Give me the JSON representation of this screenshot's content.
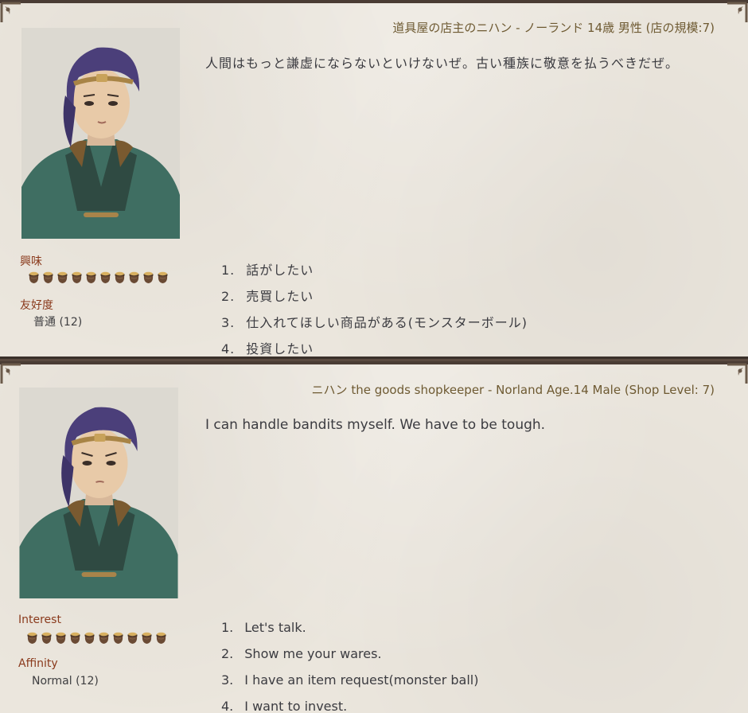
{
  "colors": {
    "paper": "#ebe6dd",
    "header_text": "#6e5a32",
    "stat_label": "#8a3a1c",
    "body_text": "#3b3b40",
    "frame": "#3a302a"
  },
  "jp": {
    "header": "道具屋の店主のニハン - ノーランド 14歳 男性 (店の規模:7)",
    "dialogue": "人間はもっと謙虚にならないといけないぜ。古い種族に敬意を払うべきだぜ。",
    "interest_label": "興味",
    "interest_level": 10,
    "affinity_label": "友好度",
    "affinity_value": "普通 (12)",
    "choices": [
      {
        "num": "1.",
        "text": "話がしたい"
      },
      {
        "num": "2.",
        "text": "売買したい"
      },
      {
        "num": "3.",
        "text": "仕入れてほしい商品がある(モンスターボール)"
      },
      {
        "num": "4.",
        "text": "投資したい"
      }
    ]
  },
  "en": {
    "header": "ニハン the goods shopkeeper - Norland Age.14 Male (Shop Level: 7)",
    "dialogue": "I can handle bandits myself. We have to be tough.",
    "interest_label": "Interest",
    "interest_level": 10,
    "affinity_label": "Affinity",
    "affinity_value": "Normal (12)",
    "choices": [
      {
        "num": "1.",
        "text": "Let's talk."
      },
      {
        "num": "2.",
        "text": "Show me your wares."
      },
      {
        "num": "3.",
        "text": "I have an item request(monster ball)"
      },
      {
        "num": "4.",
        "text": "I want to invest."
      }
    ]
  }
}
